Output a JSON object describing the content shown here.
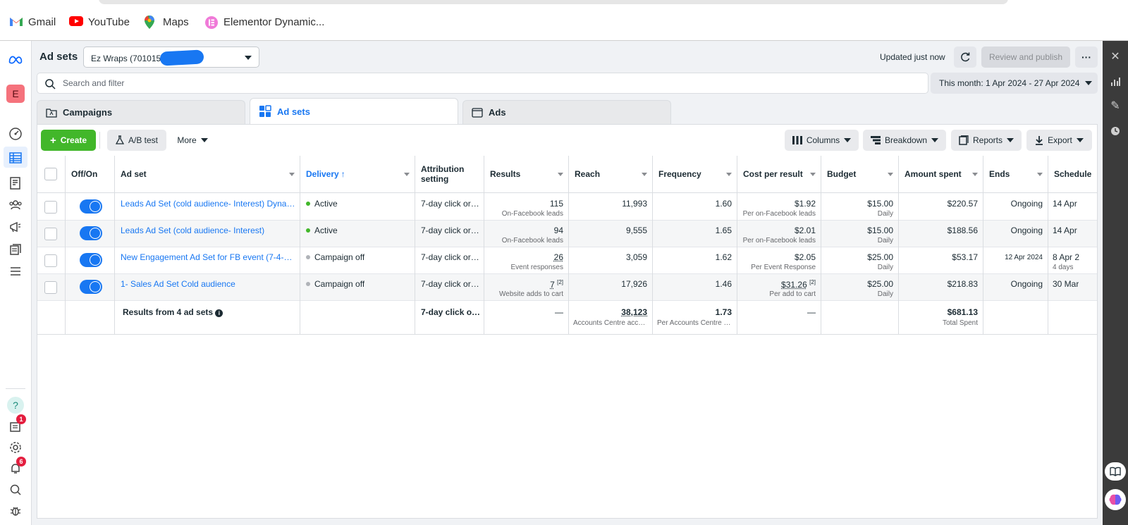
{
  "bookmarks": [
    {
      "label": "Gmail",
      "icon": "gmail-icon"
    },
    {
      "label": "YouTube",
      "icon": "youtube-icon"
    },
    {
      "label": "Maps",
      "icon": "maps-icon"
    },
    {
      "label": "Elementor Dynamic...",
      "icon": "elementor-icon"
    }
  ],
  "rail": {
    "avatar_letter": "E",
    "notification_badge_1": "1",
    "notification_badge_2": "6"
  },
  "header": {
    "title": "Ad sets",
    "account_selector": "Ez Wraps (7010150",
    "updated": "Updated just now",
    "review_button": "Review and publish",
    "more": "···"
  },
  "search": {
    "placeholder": "Search and filter"
  },
  "date_range": "This month: 1 Apr 2024 - 27 Apr 2024",
  "tabs": [
    {
      "label": "Campaigns"
    },
    {
      "label": "Ad sets"
    },
    {
      "label": "Ads"
    }
  ],
  "toolbar": {
    "create": "Create",
    "ab_test": "A/B test",
    "more": "More",
    "columns": "Columns",
    "breakdown": "Breakdown",
    "reports": "Reports",
    "export": "Export"
  },
  "table": {
    "headers": {
      "offon": "Off/On",
      "adset": "Ad set",
      "delivery": "Delivery",
      "attribution_1": "Attribution",
      "attribution_2": "setting",
      "results": "Results",
      "reach": "Reach",
      "frequency": "Frequency",
      "cpr": "Cost per result",
      "budget": "Budget",
      "spent": "Amount spent",
      "ends": "Ends",
      "schedule": "Schedule"
    },
    "rows": [
      {
        "name": "Leads Ad Set (cold audience- Interest) Dynamic...",
        "delivery": "Active",
        "delivery_color": "#42b72a",
        "attribution": "7-day click or 1...",
        "results": "115",
        "results_sub": "On-Facebook leads",
        "reach": "11,993",
        "frequency": "1.60",
        "cpr": "$1.92",
        "cpr_sub": "Per on-Facebook leads",
        "budget": "$15.00",
        "budget_sub": "Daily",
        "spent": "$220.57",
        "ends": "Ongoing",
        "schedule": "14 Apr",
        "schedule_sub": ""
      },
      {
        "name": "Leads Ad Set (cold audience- Interest)",
        "delivery": "Active",
        "delivery_color": "#42b72a",
        "attribution": "7-day click or 1...",
        "results": "94",
        "results_sub": "On-Facebook leads",
        "reach": "9,555",
        "frequency": "1.65",
        "cpr": "$2.01",
        "cpr_sub": "Per on-Facebook leads",
        "budget": "$15.00",
        "budget_sub": "Daily",
        "spent": "$188.56",
        "ends": "Ongoing",
        "schedule": "14 Apr",
        "schedule_sub": ""
      },
      {
        "name": "New Engagement Ad Set for FB event (7-4-2024)",
        "delivery": "Campaign off",
        "delivery_color": "#b0b3b8",
        "attribution": "7-day click or 1...",
        "results": "26",
        "results_sub": "Event responses",
        "reach": "3,059",
        "frequency": "1.62",
        "cpr": "$2.05",
        "cpr_sub": "Per Event Response",
        "budget": "$25.00",
        "budget_sub": "Daily",
        "spent": "$53.17",
        "ends": "12 Apr 2024",
        "schedule": "8 Apr 2",
        "schedule_sub": "4 days"
      },
      {
        "name": "1- Sales Ad Set Cold audience",
        "delivery": "Campaign off",
        "delivery_color": "#b0b3b8",
        "attribution": "7-day click or 1...",
        "results": "7",
        "results_sup": "[2]",
        "results_sub": "Website adds to cart",
        "reach": "17,926",
        "frequency": "1.46",
        "cpr": "$31.26",
        "cpr_sup": "[2]",
        "cpr_sub": "Per add to cart",
        "budget": "$25.00",
        "budget_sub": "Daily",
        "spent": "$218.83",
        "ends": "Ongoing",
        "schedule": "30 Mar",
        "schedule_sub": ""
      }
    ],
    "totals": {
      "label": "Results from 4 ad sets",
      "attribution": "7-day click or ...",
      "results": "—",
      "reach": "38,123",
      "reach_sub": "Accounts Centre acco...",
      "frequency": "1.73",
      "frequency_sub": "Per Accounts Centre a...",
      "cpr": "—",
      "spent": "$681.13",
      "spent_sub": "Total Spent"
    }
  }
}
